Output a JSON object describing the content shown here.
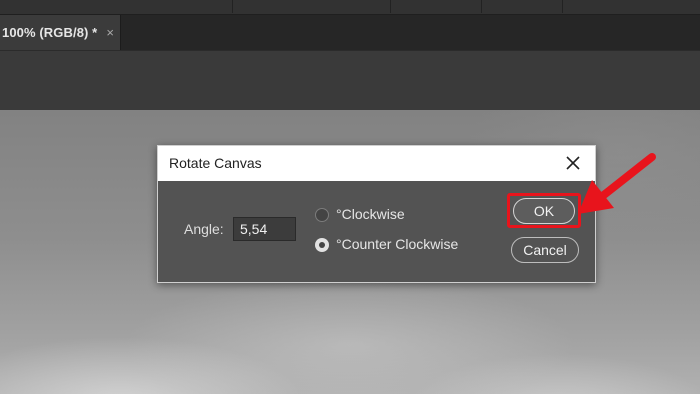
{
  "document_tab": {
    "title": "100% (RGB/8) *",
    "close_glyph": "×"
  },
  "dialog": {
    "title": "Rotate Canvas",
    "close_icon": "close-icon",
    "angle_label": "Angle:",
    "angle_value": "5,54",
    "options": [
      {
        "label": "°Clockwise",
        "selected": false
      },
      {
        "label": "°Counter Clockwise",
        "selected": true
      }
    ],
    "ok_label": "OK",
    "cancel_label": "Cancel"
  },
  "annotation": {
    "highlight_color": "#e8141c",
    "target": "OK"
  }
}
